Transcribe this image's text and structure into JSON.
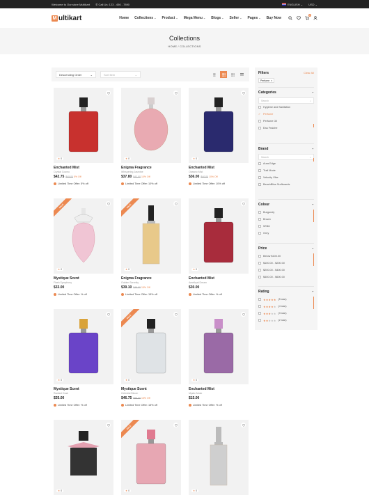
{
  "topbar": {
    "welcome": "Welcome to Our store Multikart",
    "call": "Call Us: 123 - 456 - 7890",
    "language": "ENGLISH",
    "currency": "USD"
  },
  "header": {
    "logo_mark": "M",
    "logo_text": "ultikart",
    "nav": [
      {
        "label": "Home",
        "dropdown": false
      },
      {
        "label": "Collections",
        "dropdown": true
      },
      {
        "label": "Product",
        "dropdown": true
      },
      {
        "label": "Mega Menu",
        "dropdown": true
      },
      {
        "label": "Blogs",
        "dropdown": true
      },
      {
        "label": "Seller",
        "dropdown": true
      },
      {
        "label": "Pages",
        "dropdown": true
      },
      {
        "label": "Buy Now",
        "dropdown": false
      }
    ],
    "cart_count": "0"
  },
  "banner": {
    "title": "Collections",
    "breadcrumb": "HOME / COLLECTIONS"
  },
  "toolbar": {
    "sort_value": "Descending Order",
    "sort_by_placeholder": "Sort Item"
  },
  "products": [
    {
      "name": "Enchanted Mist",
      "brand": "Crystal Cosmo",
      "price": "$42.75",
      "old": "$45.00",
      "off": "5% Off",
      "offer": "Limited Time Offer: 5% off",
      "rating": "0",
      "ribbon": "",
      "bottle": {
        "liquid": "#c8312e",
        "shape": "square",
        "cap": "#222",
        "label": ""
      }
    },
    {
      "name": "Enigma Fragrance",
      "brand": "Whispering Jasmine",
      "price": "$37.80",
      "old": "$42.00",
      "off": "10% Off",
      "offer": "Limited Time Offer: 10% off",
      "rating": "0",
      "ribbon": "",
      "bottle": {
        "liquid": "#e9aab2",
        "shape": "round",
        "cap": "#d8d0d0",
        "label": "Round Perfume Bottle"
      }
    },
    {
      "name": "Enchanted Mist",
      "brand": "Oceanic Mist",
      "price": "$36.00",
      "old": "$40.00",
      "off": "10% Off",
      "offer": "Limited Time Offer: 10% off",
      "rating": "0",
      "ribbon": "",
      "bottle": {
        "liquid": "#2a2a6e",
        "shape": "square",
        "cap": "#222",
        "label": "Perfume Bottle"
      }
    },
    {
      "name": "Mystique Scent",
      "brand": "Flash Symphony",
      "price": "$33.00",
      "old": "",
      "off": "",
      "offer": "Limited Time Offer: % off",
      "rating": "0",
      "ribbon": "SALE",
      "bottle": {
        "liquid": "#f0c5d4",
        "shape": "flower",
        "cap": "#e6e6e6",
        "label": ""
      }
    },
    {
      "name": "Enigma Fragrance",
      "brand": "Golden Serenity",
      "price": "$39.10",
      "old": "$46.00",
      "off": "15% Off",
      "offer": "Limited Time Offer: 15% off",
      "rating": "0",
      "ribbon": "SALE",
      "bottle": {
        "liquid": "#e8c98a",
        "shape": "slim",
        "cap": "#222",
        "label": "Perfume"
      }
    },
    {
      "name": "Enchanted Mist",
      "brand": "Amethyst Dream",
      "price": "$30.00",
      "old": "",
      "off": "",
      "offer": "Limited Time Offer: % off",
      "rating": "0",
      "ribbon": "",
      "bottle": {
        "liquid": "#a82c3c",
        "shape": "square",
        "cap": "#222",
        "label": ""
      }
    },
    {
      "name": "Mystique Scent",
      "brand": "Radiant Dusk",
      "price": "$35.00",
      "old": "",
      "off": "",
      "offer": "Limited Time Offer: % off",
      "rating": "0",
      "ribbon": "",
      "bottle": {
        "liquid": "#6a44c8",
        "shape": "square",
        "cap": "#d9a33a",
        "label": "PERFUME"
      }
    },
    {
      "name": "Mystique Scent",
      "brand": "Celestial Bloom",
      "price": "$46.75",
      "old": "$55.00",
      "off": "15% Off",
      "offer": "Limited Time Offer: 15% off",
      "rating": "0",
      "ribbon": "SALE",
      "bottle": {
        "liquid": "#dfe3e6",
        "shape": "square",
        "cap": "#222",
        "label": "Le Perfume"
      }
    },
    {
      "name": "Enchanted Mist",
      "brand": "Mystic Musk",
      "price": "$15.00",
      "old": "",
      "off": "",
      "offer": "Limited Time Offer: % off",
      "rating": "0",
      "ribbon": "",
      "bottle": {
        "liquid": "#9a6aa6",
        "shape": "square",
        "cap": "#c98fc9",
        "label": ""
      }
    },
    {
      "name": "",
      "brand": "",
      "price": "",
      "old": "",
      "off": "",
      "offer": "",
      "rating": "0",
      "ribbon": "",
      "bottle": {
        "liquid": "#222",
        "shape": "bow",
        "cap": "#222",
        "label": ""
      }
    },
    {
      "name": "",
      "brand": "",
      "price": "",
      "old": "",
      "off": "",
      "offer": "",
      "rating": "0",
      "ribbon": "SALE",
      "bottle": {
        "liquid": "#e7a7b3",
        "shape": "square",
        "cap": "#e07a90",
        "label": ""
      }
    },
    {
      "name": "",
      "brand": "",
      "price": "",
      "old": "",
      "off": "",
      "offer": "",
      "rating": "0",
      "ribbon": "",
      "bottle": {
        "liquid": "#cfcfcf",
        "shape": "slim",
        "cap": "#bbb",
        "label": ""
      }
    }
  ],
  "sidebar": {
    "title": "Filters",
    "clear": "Clear All",
    "chip": "Perfume",
    "categories": {
      "title": "Categories",
      "search": "Search",
      "items": [
        {
          "label": "Hygiene and Sanitation",
          "checked": false
        },
        {
          "label": "Perfume",
          "checked": true
        },
        {
          "label": "Perfume Oil",
          "checked": false
        },
        {
          "label": "Eau Fraiche",
          "checked": false
        }
      ]
    },
    "brand": {
      "title": "Brand",
      "search": "Search",
      "items": [
        "Aura Edge",
        "Trail Mode",
        "Velocity Vibe",
        "BeachBliss Surfboards"
      ]
    },
    "colour": {
      "title": "Colour",
      "items": [
        "Burgundy",
        "Brown",
        "White",
        "Grey"
      ]
    },
    "price": {
      "title": "Price",
      "items": [
        "Below $100.00",
        "$100.00 - $200.00",
        "$200.00 - $400.00",
        "$400.00 - $600.00"
      ]
    },
    "rating": {
      "title": "Rating",
      "items": [
        {
          "stars": 5,
          "label": "(5 star)"
        },
        {
          "stars": 4,
          "label": "(4 star)"
        },
        {
          "stars": 3,
          "label": "(3 star)"
        },
        {
          "stars": 2,
          "label": "(2 star)"
        }
      ]
    }
  },
  "colors": {
    "accent": "#ec8951",
    "dark": "#232323",
    "panel": "#f5f5f5"
  }
}
